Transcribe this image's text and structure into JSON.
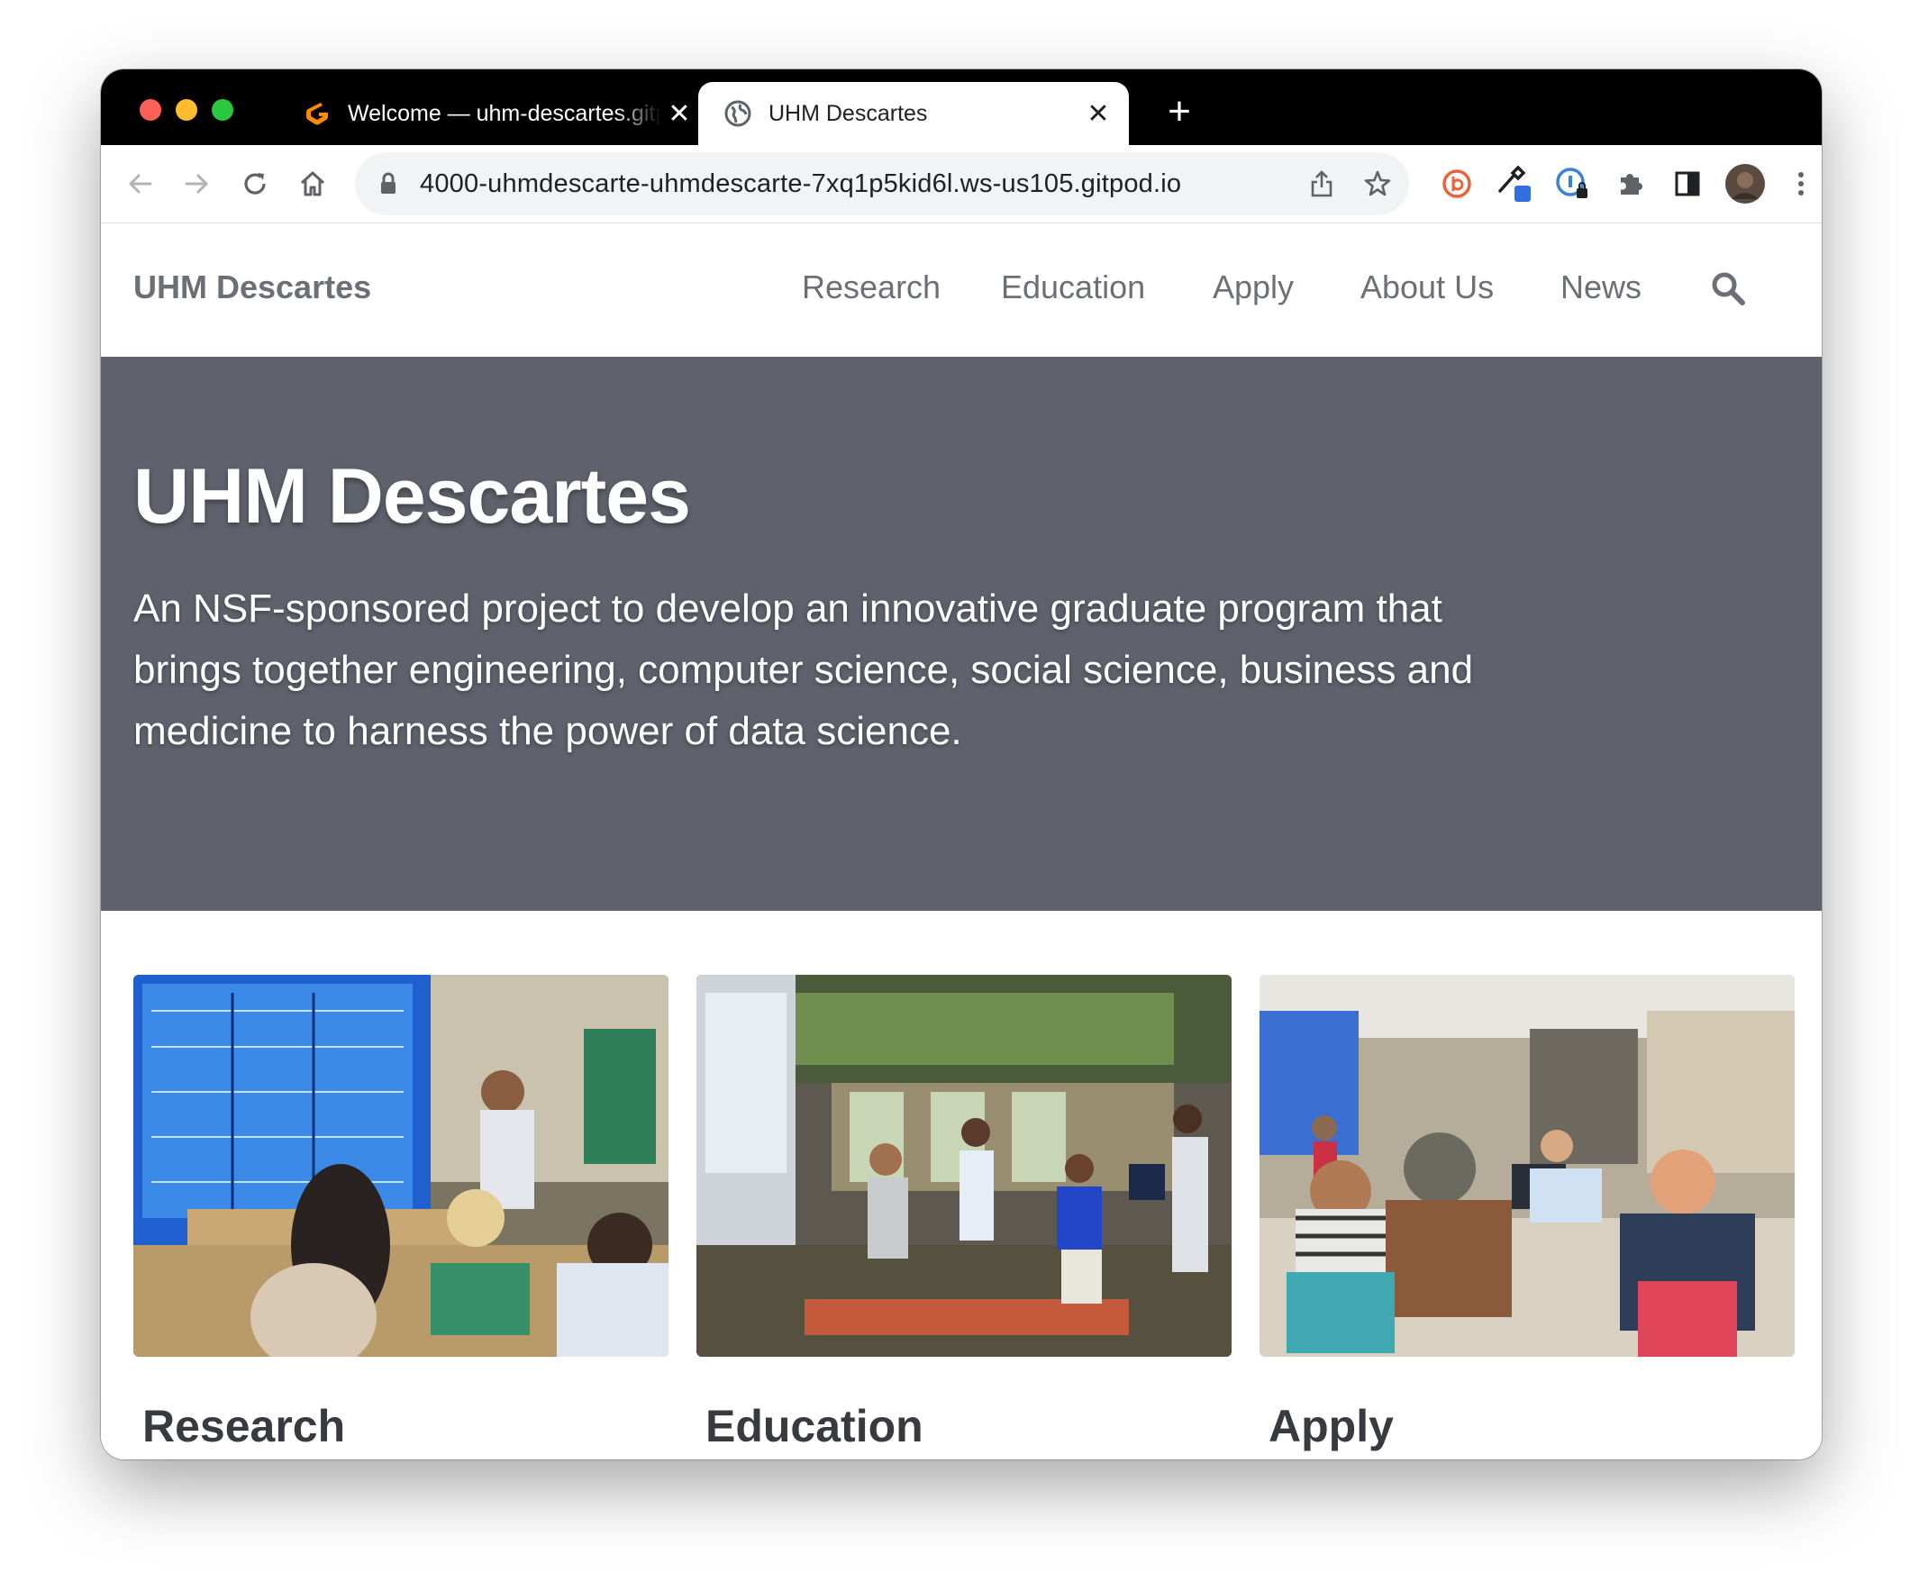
{
  "browser": {
    "tabs": [
      {
        "title": "Welcome — uhm-descartes.gitpod.io",
        "active": false,
        "favicon": "gitpod-icon"
      },
      {
        "title": "UHM Descartes",
        "active": true,
        "favicon": "globe-icon"
      }
    ],
    "close_glyph": "✕",
    "new_tab_glyph": "+",
    "url": "4000-uhmdescarte-uhmdescarte-7xq1p5kid6l.ws-us105.gitpod.io"
  },
  "site": {
    "brand": "UHM Descartes",
    "nav": [
      "Research",
      "Education",
      "Apply",
      "About Us",
      "News"
    ]
  },
  "hero": {
    "title": "UHM Descartes",
    "description": "An NSF-sponsored project to develop an innovative graduate program that brings together engineering, computer science, social science, business and medicine to harness the power of data science."
  },
  "cards": [
    {
      "title": "Research",
      "image": "research-photo"
    },
    {
      "title": "Education",
      "image": "education-photo"
    },
    {
      "title": "Apply",
      "image": "apply-photo"
    }
  ]
}
